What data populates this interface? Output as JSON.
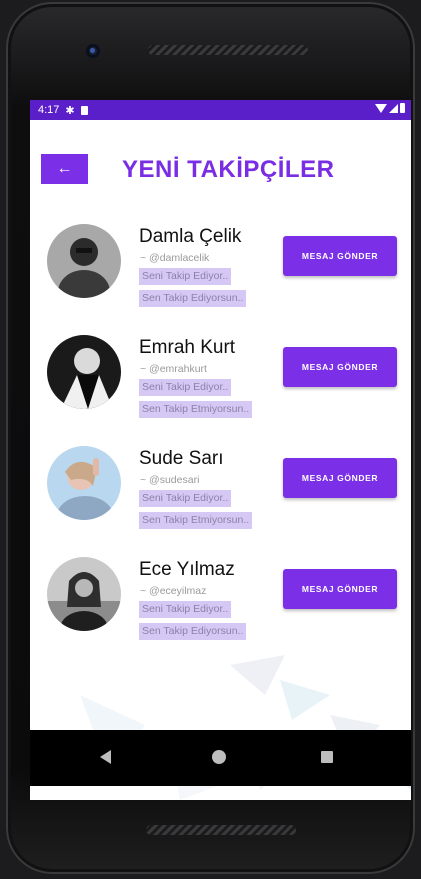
{
  "status": {
    "time": "4:17"
  },
  "header": {
    "title": "YENİ TAKİPÇİLER",
    "back_label": "←"
  },
  "followers": [
    {
      "name": "Damla Çelik",
      "handle": "~ @damlacelik",
      "follows_you": "Seni Takip Ediyor..",
      "you_follow": "Sen Takip Ediyorsun..",
      "button": "MESAJ GÖNDER"
    },
    {
      "name": "Emrah Kurt",
      "handle": "~ @emrahkurt",
      "follows_you": "Seni Takip Ediyor..",
      "you_follow": "Sen Takip Etmiyorsun..",
      "button": "MESAJ GÖNDER"
    },
    {
      "name": "Sude Sarı",
      "handle": "~ @sudesari",
      "follows_you": "Seni Takip Ediyor..",
      "you_follow": "Sen Takip Etmiyorsun..",
      "button": "MESAJ GÖNDER"
    },
    {
      "name": "Ece Yılmaz",
      "handle": "~ @eceyilmaz",
      "follows_you": "Seni Takip Ediyor..",
      "you_follow": "Sen Takip Ediyorsun..",
      "button": "MESAJ GÖNDER"
    }
  ],
  "colors": {
    "primary": "#7b2fe6",
    "status_bar": "#5b1fc9",
    "tag_bg": "#d6c8f4"
  },
  "icons": {
    "status": [
      "gear-icon",
      "sim-card-icon",
      "wifi-icon",
      "signal-icon",
      "battery-icon"
    ],
    "nav": [
      "nav-back-icon",
      "nav-home-icon",
      "nav-recents-icon"
    ]
  }
}
